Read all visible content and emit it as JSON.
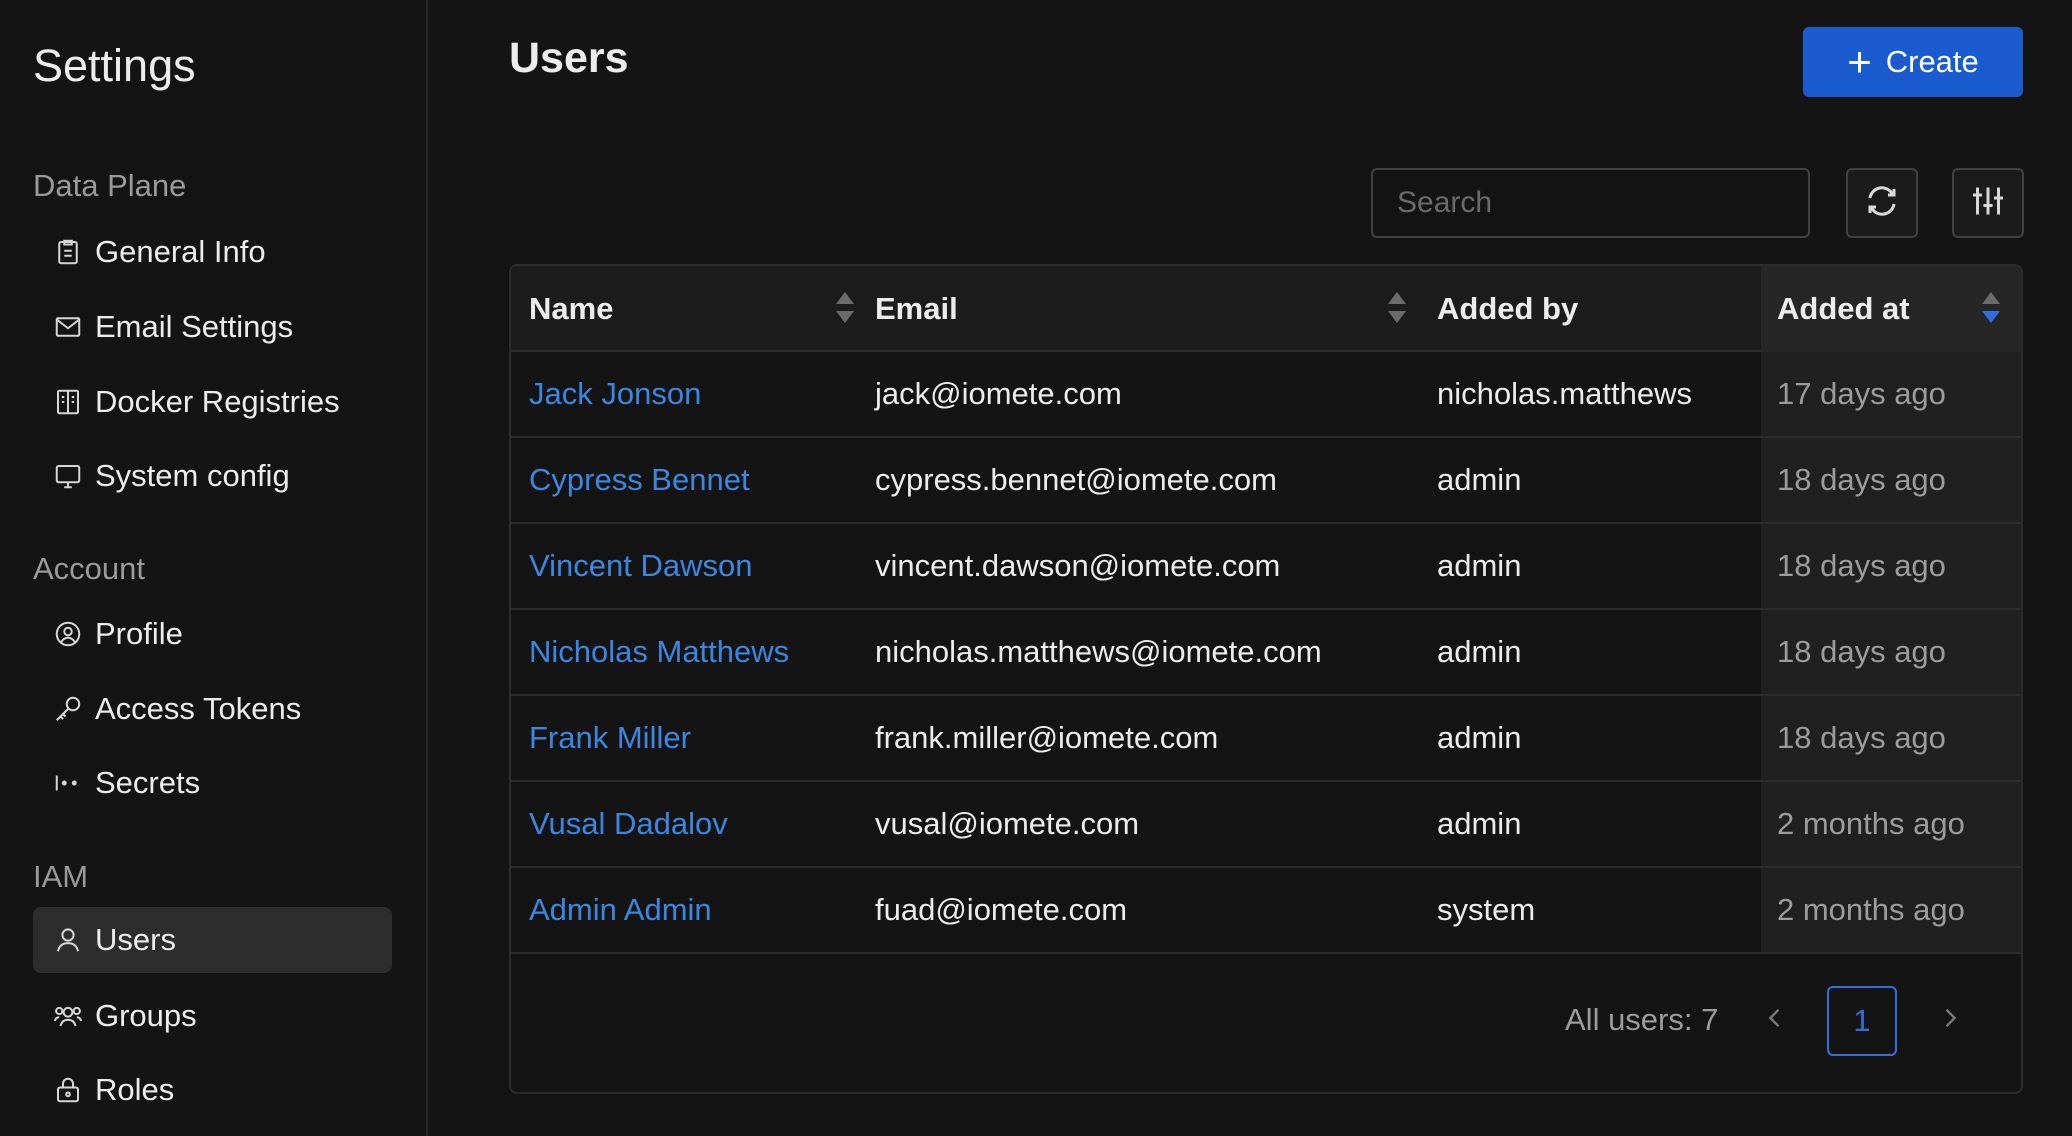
{
  "sidebar": {
    "title": "Settings",
    "sections": [
      {
        "label": "Data Plane",
        "items": [
          {
            "label": "General Info",
            "icon": "clipboard-icon"
          },
          {
            "label": "Email Settings",
            "icon": "mail-icon"
          },
          {
            "label": "Docker Registries",
            "icon": "book-icon"
          },
          {
            "label": "System config",
            "icon": "monitor-icon"
          }
        ]
      },
      {
        "label": "Account",
        "items": [
          {
            "label": "Profile",
            "icon": "user-circle-icon"
          },
          {
            "label": "Access Tokens",
            "icon": "key-icon"
          },
          {
            "label": "Secrets",
            "icon": "secret-icon"
          }
        ]
      },
      {
        "label": "IAM",
        "items": [
          {
            "label": "Users",
            "icon": "user-icon",
            "active": true
          },
          {
            "label": "Groups",
            "icon": "users-icon"
          },
          {
            "label": "Roles",
            "icon": "lock-icon"
          }
        ]
      }
    ]
  },
  "main": {
    "title": "Users",
    "create_label": "Create",
    "search_placeholder": "Search"
  },
  "table": {
    "columns": [
      "Name",
      "Email",
      "Added by",
      "Added at"
    ],
    "sort_column": "Added at",
    "sort_direction": "descending",
    "rows": [
      {
        "name": "Jack Jonson",
        "email": "jack@iomete.com",
        "added_by": "nicholas.matthews",
        "added_at": "17 days ago"
      },
      {
        "name": "Cypress Bennet",
        "email": "cypress.bennet@iomete.com",
        "added_by": "admin",
        "added_at": "18 days ago"
      },
      {
        "name": "Vincent Dawson",
        "email": "vincent.dawson@iomete.com",
        "added_by": "admin",
        "added_at": "18 days ago"
      },
      {
        "name": "Nicholas Matthews",
        "email": "nicholas.matthews@iomete.com",
        "added_by": "admin",
        "added_at": "18 days ago"
      },
      {
        "name": "Frank Miller",
        "email": "frank.miller@iomete.com",
        "added_by": "admin",
        "added_at": "18 days ago"
      },
      {
        "name": "Vusal Dadalov",
        "email": "vusal@iomete.com",
        "added_by": "admin",
        "added_at": "2 months ago"
      },
      {
        "name": "Admin Admin",
        "email": "fuad@iomete.com",
        "added_by": "system",
        "added_at": "2 months ago"
      }
    ]
  },
  "pagination": {
    "total_label": "All users: 7",
    "current_page": "1"
  },
  "colors": {
    "accent": "#1a5cd0",
    "link": "#3d86e0",
    "background": "#141414"
  }
}
